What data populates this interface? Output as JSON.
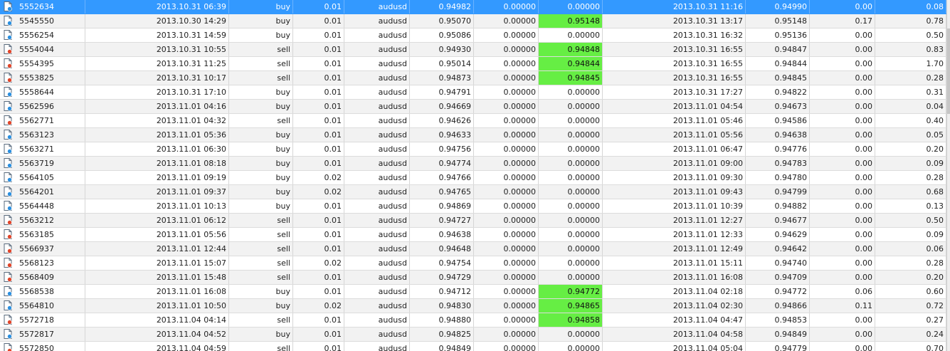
{
  "table": {
    "rows": [
      {
        "ticket": "5552634",
        "open_time": "2013.10.31 06:39",
        "type": "buy",
        "size": "0.01",
        "item": "audusd",
        "price": "0.94982",
        "sl": "0.00000",
        "tp": "0.00000",
        "close_time": "2013.10.31 11:16",
        "close_price": "0.94990",
        "commission": "0.00",
        "profit": "0.08",
        "tp_hit": false,
        "selected": true
      },
      {
        "ticket": "5545550",
        "open_time": "2013.10.30 14:29",
        "type": "buy",
        "size": "0.01",
        "item": "audusd",
        "price": "0.95070",
        "sl": "0.00000",
        "tp": "0.95148",
        "close_time": "2013.10.31 13:17",
        "close_price": "0.95148",
        "commission": "0.17",
        "profit": "0.78",
        "tp_hit": true
      },
      {
        "ticket": "5556254",
        "open_time": "2013.10.31 14:59",
        "type": "buy",
        "size": "0.01",
        "item": "audusd",
        "price": "0.95086",
        "sl": "0.00000",
        "tp": "0.00000",
        "close_time": "2013.10.31 16:32",
        "close_price": "0.95136",
        "commission": "0.00",
        "profit": "0.50",
        "tp_hit": false
      },
      {
        "ticket": "5554044",
        "open_time": "2013.10.31 10:55",
        "type": "sell",
        "size": "0.01",
        "item": "audusd",
        "price": "0.94930",
        "sl": "0.00000",
        "tp": "0.94848",
        "close_time": "2013.10.31 16:55",
        "close_price": "0.94847",
        "commission": "0.00",
        "profit": "0.83",
        "tp_hit": true
      },
      {
        "ticket": "5554395",
        "open_time": "2013.10.31 11:25",
        "type": "sell",
        "size": "0.01",
        "item": "audusd",
        "price": "0.95014",
        "sl": "0.00000",
        "tp": "0.94844",
        "close_time": "2013.10.31 16:55",
        "close_price": "0.94844",
        "commission": "0.00",
        "profit": "1.70",
        "tp_hit": true
      },
      {
        "ticket": "5553825",
        "open_time": "2013.10.31 10:17",
        "type": "sell",
        "size": "0.01",
        "item": "audusd",
        "price": "0.94873",
        "sl": "0.00000",
        "tp": "0.94845",
        "close_time": "2013.10.31 16:55",
        "close_price": "0.94845",
        "commission": "0.00",
        "profit": "0.28",
        "tp_hit": true
      },
      {
        "ticket": "5558644",
        "open_time": "2013.10.31 17:10",
        "type": "buy",
        "size": "0.01",
        "item": "audusd",
        "price": "0.94791",
        "sl": "0.00000",
        "tp": "0.00000",
        "close_time": "2013.10.31 17:27",
        "close_price": "0.94822",
        "commission": "0.00",
        "profit": "0.31",
        "tp_hit": false
      },
      {
        "ticket": "5562596",
        "open_time": "2013.11.01 04:16",
        "type": "buy",
        "size": "0.01",
        "item": "audusd",
        "price": "0.94669",
        "sl": "0.00000",
        "tp": "0.00000",
        "close_time": "2013.11.01 04:54",
        "close_price": "0.94673",
        "commission": "0.00",
        "profit": "0.04",
        "tp_hit": false
      },
      {
        "ticket": "5562771",
        "open_time": "2013.11.01 04:32",
        "type": "sell",
        "size": "0.01",
        "item": "audusd",
        "price": "0.94626",
        "sl": "0.00000",
        "tp": "0.00000",
        "close_time": "2013.11.01 05:46",
        "close_price": "0.94586",
        "commission": "0.00",
        "profit": "0.40",
        "tp_hit": false
      },
      {
        "ticket": "5563123",
        "open_time": "2013.11.01 05:36",
        "type": "buy",
        "size": "0.01",
        "item": "audusd",
        "price": "0.94633",
        "sl": "0.00000",
        "tp": "0.00000",
        "close_time": "2013.11.01 05:56",
        "close_price": "0.94638",
        "commission": "0.00",
        "profit": "0.05",
        "tp_hit": false
      },
      {
        "ticket": "5563271",
        "open_time": "2013.11.01 06:30",
        "type": "buy",
        "size": "0.01",
        "item": "audusd",
        "price": "0.94756",
        "sl": "0.00000",
        "tp": "0.00000",
        "close_time": "2013.11.01 06:47",
        "close_price": "0.94776",
        "commission": "0.00",
        "profit": "0.20",
        "tp_hit": false
      },
      {
        "ticket": "5563719",
        "open_time": "2013.11.01 08:18",
        "type": "buy",
        "size": "0.01",
        "item": "audusd",
        "price": "0.94774",
        "sl": "0.00000",
        "tp": "0.00000",
        "close_time": "2013.11.01 09:00",
        "close_price": "0.94783",
        "commission": "0.00",
        "profit": "0.09",
        "tp_hit": false
      },
      {
        "ticket": "5564105",
        "open_time": "2013.11.01 09:19",
        "type": "buy",
        "size": "0.02",
        "item": "audusd",
        "price": "0.94766",
        "sl": "0.00000",
        "tp": "0.00000",
        "close_time": "2013.11.01 09:30",
        "close_price": "0.94780",
        "commission": "0.00",
        "profit": "0.28",
        "tp_hit": false
      },
      {
        "ticket": "5564201",
        "open_time": "2013.11.01 09:37",
        "type": "buy",
        "size": "0.02",
        "item": "audusd",
        "price": "0.94765",
        "sl": "0.00000",
        "tp": "0.00000",
        "close_time": "2013.11.01 09:43",
        "close_price": "0.94799",
        "commission": "0.00",
        "profit": "0.68",
        "tp_hit": false
      },
      {
        "ticket": "5564448",
        "open_time": "2013.11.01 10:13",
        "type": "buy",
        "size": "0.01",
        "item": "audusd",
        "price": "0.94869",
        "sl": "0.00000",
        "tp": "0.00000",
        "close_time": "2013.11.01 10:39",
        "close_price": "0.94882",
        "commission": "0.00",
        "profit": "0.13",
        "tp_hit": false
      },
      {
        "ticket": "5563212",
        "open_time": "2013.11.01 06:12",
        "type": "sell",
        "size": "0.01",
        "item": "audusd",
        "price": "0.94727",
        "sl": "0.00000",
        "tp": "0.00000",
        "close_time": "2013.11.01 12:27",
        "close_price": "0.94677",
        "commission": "0.00",
        "profit": "0.50",
        "tp_hit": false
      },
      {
        "ticket": "5563185",
        "open_time": "2013.11.01 05:56",
        "type": "sell",
        "size": "0.01",
        "item": "audusd",
        "price": "0.94638",
        "sl": "0.00000",
        "tp": "0.00000",
        "close_time": "2013.11.01 12:33",
        "close_price": "0.94629",
        "commission": "0.00",
        "profit": "0.09",
        "tp_hit": false
      },
      {
        "ticket": "5566937",
        "open_time": "2013.11.01 12:44",
        "type": "sell",
        "size": "0.01",
        "item": "audusd",
        "price": "0.94648",
        "sl": "0.00000",
        "tp": "0.00000",
        "close_time": "2013.11.01 12:49",
        "close_price": "0.94642",
        "commission": "0.00",
        "profit": "0.06",
        "tp_hit": false
      },
      {
        "ticket": "5568123",
        "open_time": "2013.11.01 15:07",
        "type": "sell",
        "size": "0.02",
        "item": "audusd",
        "price": "0.94754",
        "sl": "0.00000",
        "tp": "0.00000",
        "close_time": "2013.11.01 15:11",
        "close_price": "0.94740",
        "commission": "0.00",
        "profit": "0.28",
        "tp_hit": false
      },
      {
        "ticket": "5568409",
        "open_time": "2013.11.01 15:48",
        "type": "sell",
        "size": "0.01",
        "item": "audusd",
        "price": "0.94729",
        "sl": "0.00000",
        "tp": "0.00000",
        "close_time": "2013.11.01 16:08",
        "close_price": "0.94709",
        "commission": "0.00",
        "profit": "0.20",
        "tp_hit": false
      },
      {
        "ticket": "5568538",
        "open_time": "2013.11.01 16:08",
        "type": "buy",
        "size": "0.01",
        "item": "audusd",
        "price": "0.94712",
        "sl": "0.00000",
        "tp": "0.94772",
        "close_time": "2013.11.04 02:18",
        "close_price": "0.94772",
        "commission": "0.06",
        "profit": "0.60",
        "tp_hit": true
      },
      {
        "ticket": "5564810",
        "open_time": "2013.11.01 10:50",
        "type": "buy",
        "size": "0.02",
        "item": "audusd",
        "price": "0.94830",
        "sl": "0.00000",
        "tp": "0.94865",
        "close_time": "2013.11.04 02:30",
        "close_price": "0.94866",
        "commission": "0.11",
        "profit": "0.72",
        "tp_hit": true
      },
      {
        "ticket": "5572718",
        "open_time": "2013.11.04 04:14",
        "type": "sell",
        "size": "0.01",
        "item": "audusd",
        "price": "0.94880",
        "sl": "0.00000",
        "tp": "0.94858",
        "close_time": "2013.11.04 04:47",
        "close_price": "0.94853",
        "commission": "0.00",
        "profit": "0.27",
        "tp_hit": true
      },
      {
        "ticket": "5572817",
        "open_time": "2013.11.04 04:52",
        "type": "buy",
        "size": "0.01",
        "item": "audusd",
        "price": "0.94825",
        "sl": "0.00000",
        "tp": "0.00000",
        "close_time": "2013.11.04 04:58",
        "close_price": "0.94849",
        "commission": "0.00",
        "profit": "0.24",
        "tp_hit": false
      },
      {
        "ticket": "5572850",
        "open_time": "2013.11.04 04:59",
        "type": "sell",
        "size": "0.01",
        "item": "audusd",
        "price": "0.94849",
        "sl": "0.00000",
        "tp": "0.00000",
        "close_time": "2013.11.04 05:04",
        "close_price": "0.94779",
        "commission": "0.00",
        "profit": "0.70",
        "tp_hit": false
      }
    ]
  },
  "colors": {
    "selected_row": "#3399ff",
    "tp_highlight": "#66ee44",
    "buy_icon": "#2a8fe0",
    "sell_icon": "#e0452a"
  },
  "icons": {
    "buy": "buy-order-icon",
    "sell": "sell-order-icon"
  }
}
